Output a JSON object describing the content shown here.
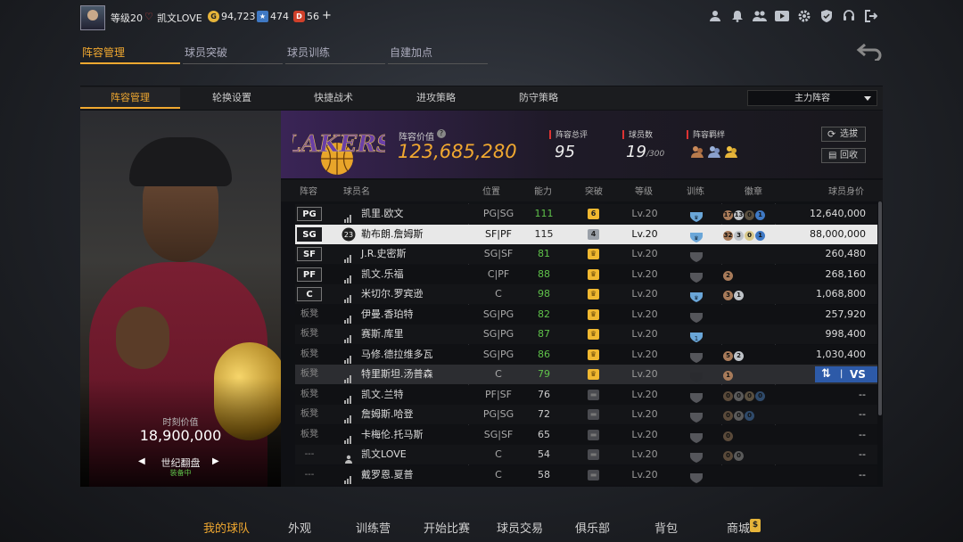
{
  "topbar": {
    "level": "等级20",
    "username": "凯文LOVE",
    "gold": "94,723",
    "stars": "474",
    "tickets": "56",
    "plus": "+"
  },
  "main_tabs": [
    {
      "label": "阵容管理",
      "active": true
    },
    {
      "label": "球员突破",
      "active": false
    },
    {
      "label": "球员训练",
      "active": false
    },
    {
      "label": "自建加点",
      "active": false
    }
  ],
  "sub_tabs": [
    {
      "label": "阵容管理",
      "active": true
    },
    {
      "label": "轮换设置",
      "active": false
    },
    {
      "label": "快捷战术",
      "active": false
    },
    {
      "label": "进攻策略",
      "active": false
    },
    {
      "label": "防守策略",
      "active": false
    }
  ],
  "lineup_dropdown": "主力阵容",
  "card": {
    "time_value_label": "时刻价值",
    "time_value": "18,900,000",
    "name": "世纪翻盘",
    "equipped": "装备中"
  },
  "team": {
    "logo_text": "LAKERS",
    "value_label": "阵容价值",
    "value": "123,685,280",
    "rating_label": "阵容总评",
    "rating": "95",
    "count_label": "球员数",
    "count": "19",
    "count_max": "/300",
    "bond_label": "阵容羁绊",
    "btn_select": "选拔",
    "btn_recycle": "回收"
  },
  "columns": [
    "阵容",
    "球员名",
    "位置",
    "能力",
    "突破",
    "等级",
    "训练",
    "徽章",
    "球员身价"
  ],
  "rows": [
    {
      "slot": "PG",
      "name": "凯里.欧文",
      "pos": "PG|SG",
      "ability": "111",
      "ability_color": "#5fc24a",
      "tier": "6",
      "tier_style": "gold",
      "level": "Lv.20",
      "train": "blue",
      "badges": [
        [
          "17",
          "#a87b5a"
        ],
        [
          "13",
          "#bfc3c8"
        ],
        [
          "0",
          "#5a5040"
        ],
        [
          "1",
          "#3f79c4"
        ]
      ],
      "price": "12,640,000",
      "selected": false
    },
    {
      "slot": "SG",
      "name": "勒布朗.詹姆斯",
      "pos": "SF|PF",
      "ability": "115",
      "ability_color": "#222",
      "tier": "4",
      "tier_style": "silver",
      "level": "Lv.20",
      "train": "blue",
      "badges": [
        [
          "32",
          "#a87b5a"
        ],
        [
          "3",
          "#bfc3c8"
        ],
        [
          "0",
          "#d8c88a"
        ],
        [
          "1",
          "#3f79c4"
        ]
      ],
      "price": "88,000,000",
      "selected": true
    },
    {
      "slot": "SF",
      "name": "J.R.史密斯",
      "pos": "SG|SF",
      "ability": "81",
      "ability_color": "#5fc24a",
      "tier": "",
      "tier_style": "crown",
      "level": "Lv.20",
      "train": "gray",
      "badges": [],
      "price": "260,480",
      "selected": false
    },
    {
      "slot": "PF",
      "name": "凯文.乐福",
      "pos": "C|PF",
      "ability": "88",
      "ability_color": "#5fc24a",
      "tier": "",
      "tier_style": "crown",
      "level": "Lv.20",
      "train": "gray",
      "badges": [
        [
          "2",
          "#a87b5a"
        ]
      ],
      "price": "268,160",
      "selected": false
    },
    {
      "slot": "C",
      "name": "米切尔.罗宾逊",
      "pos": "C",
      "ability": "98",
      "ability_color": "#5fc24a",
      "tier": "",
      "tier_style": "crown",
      "level": "Lv.20",
      "train": "blue",
      "badges": [
        [
          "3",
          "#a87b5a"
        ],
        [
          "1",
          "#bfc3c8"
        ]
      ],
      "price": "1,068,800",
      "selected": false
    },
    {
      "slot": "板凳",
      "name": "伊曼.香珀特",
      "pos": "SG|PG",
      "ability": "82",
      "ability_color": "#5fc24a",
      "tier": "",
      "tier_style": "crown",
      "level": "Lv.20",
      "train": "gray",
      "badges": [],
      "price": "257,920",
      "selected": false
    },
    {
      "slot": "板凳",
      "name": "赛斯.库里",
      "pos": "SG|PG",
      "ability": "87",
      "ability_color": "#5fc24a",
      "tier": "",
      "tier_style": "crown",
      "level": "Lv.20",
      "train": "blue1",
      "badges": [],
      "price": "998,400",
      "selected": false
    },
    {
      "slot": "板凳",
      "name": "马修.德拉维多瓦",
      "pos": "SG|PG",
      "ability": "86",
      "ability_color": "#5fc24a",
      "tier": "",
      "tier_style": "crown",
      "level": "Lv.20",
      "train": "gray",
      "badges": [
        [
          "5",
          "#a87b5a"
        ],
        [
          "2",
          "#bfc3c8"
        ]
      ],
      "price": "1,030,400",
      "selected": false
    },
    {
      "slot": "板凳",
      "name": "特里斯坦.汤普森",
      "pos": "C",
      "ability": "79",
      "ability_color": "#5fc24a",
      "tier": "",
      "tier_style": "crown",
      "level": "Lv.20",
      "train": "dark",
      "badges": [
        [
          "1",
          "#a87b5a"
        ]
      ],
      "price": "",
      "selected": false,
      "hover": true
    },
    {
      "slot": "板凳",
      "name": "凯文.兰特",
      "pos": "PF|SF",
      "ability": "76",
      "ability_color": "#ccc",
      "tier": "",
      "tier_style": "grayshield",
      "level": "Lv.20",
      "train": "gray",
      "badges": [
        [
          "0",
          "#5a4a3a"
        ],
        [
          "0",
          "#5a5a5a"
        ],
        [
          "0",
          "#5a5040"
        ],
        [
          "0",
          "#2f4a6a"
        ]
      ],
      "price": "--",
      "selected": false
    },
    {
      "slot": "板凳",
      "name": "詹姆斯.哈登",
      "pos": "PG|SG",
      "ability": "72",
      "ability_color": "#ccc",
      "tier": "",
      "tier_style": "grayshield",
      "level": "Lv.20",
      "train": "gray",
      "badges": [
        [
          "0",
          "#5a4a3a"
        ],
        [
          "0",
          "#5a5a5a"
        ],
        [
          "0",
          "#2f4a6a"
        ]
      ],
      "price": "--",
      "selected": false
    },
    {
      "slot": "板凳",
      "name": "卡梅伦.托马斯",
      "pos": "SG|SF",
      "ability": "65",
      "ability_color": "#ccc",
      "tier": "",
      "tier_style": "grayshield",
      "level": "Lv.20",
      "train": "gray",
      "badges": [
        [
          "0",
          "#5a4a3a"
        ]
      ],
      "price": "--",
      "selected": false
    },
    {
      "slot": "---",
      "name": "凯文LOVE",
      "pos": "C",
      "ability": "54",
      "ability_color": "#ccc",
      "tier": "",
      "tier_style": "grayshield",
      "level": "Lv.20",
      "train": "gray",
      "badges": [
        [
          "0",
          "#5a4a3a"
        ],
        [
          "0",
          "#5a5a5a"
        ]
      ],
      "price": "--",
      "selected": false,
      "self": true
    },
    {
      "slot": "---",
      "name": "戴罗恩.夏普",
      "pos": "C",
      "ability": "58",
      "ability_color": "#ccc",
      "tier": "",
      "tier_style": "grayshield",
      "level": "Lv.20",
      "train": "gray",
      "badges": [],
      "price": "--",
      "selected": false
    }
  ],
  "hover_actions": {
    "swap": "⇅",
    "vs": "VS"
  },
  "bottom_nav": [
    {
      "label": "我的球队",
      "active": true
    },
    {
      "label": "外观",
      "active": false
    },
    {
      "label": "训练营",
      "active": false
    },
    {
      "label": "开始比赛",
      "active": false
    },
    {
      "label": "球员交易",
      "active": false
    },
    {
      "label": "俱乐部",
      "active": false
    },
    {
      "label": "背包",
      "active": false
    },
    {
      "label": "商城",
      "active": false
    }
  ],
  "colors": {
    "accent": "#f0a830",
    "ability_green": "#5fc24a",
    "badge_blue": "#3f79c4",
    "purple": "#3a2456"
  }
}
